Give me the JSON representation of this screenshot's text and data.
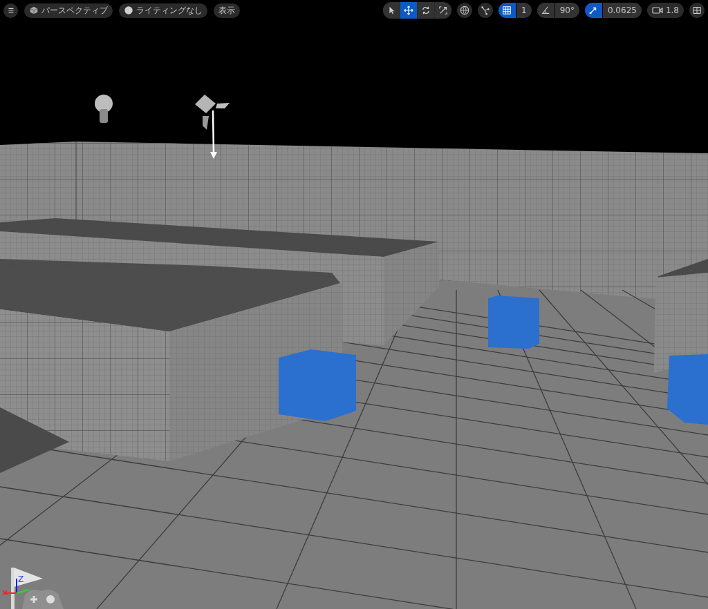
{
  "toolbar_left": [
    {
      "kind": "menu"
    },
    {
      "kind": "viewmode",
      "label": "パースペクティブ"
    },
    {
      "kind": "lighting",
      "label": "ライティングなし"
    },
    {
      "kind": "text",
      "label": "表示"
    }
  ],
  "transform_tools": [
    {
      "kind": "select",
      "selected": false
    },
    {
      "kind": "move",
      "selected": true
    },
    {
      "kind": "rotate",
      "selected": false
    },
    {
      "kind": "scale",
      "selected": false
    }
  ],
  "grid_snap": {
    "on": true,
    "value": "1"
  },
  "rotation_snap": {
    "on": false,
    "value": "90°"
  },
  "scale_snap": {
    "on": true,
    "value": "0.0625"
  },
  "camera_speed": "1.8",
  "gizmo": {
    "axis_label": "Z"
  }
}
